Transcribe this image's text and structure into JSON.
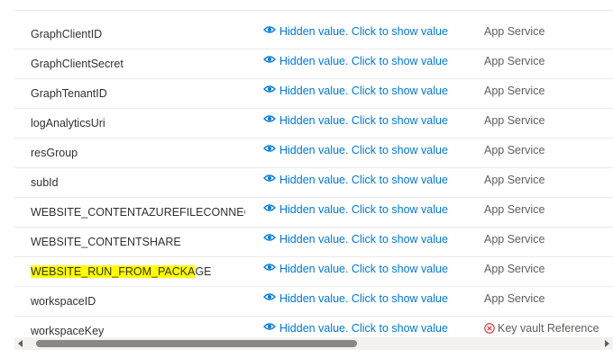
{
  "colors": {
    "link": "#0078d4",
    "text": "#323130",
    "muted": "#605e5c",
    "error": "#d13438",
    "highlight": "#ffff00"
  },
  "settings": [
    {
      "name": "GraphClientID",
      "value_text": "Hidden value. Click to show value",
      "source": "App Service",
      "source_icon": ""
    },
    {
      "name": "GraphClientSecret",
      "value_text": "Hidden value. Click to show value",
      "source": "App Service",
      "source_icon": ""
    },
    {
      "name": "GraphTenantID",
      "value_text": "Hidden value. Click to show value",
      "source": "App Service",
      "source_icon": ""
    },
    {
      "name": "logAnalyticsUri",
      "value_text": "Hidden value. Click to show value",
      "source": "App Service",
      "source_icon": ""
    },
    {
      "name": "resGroup",
      "value_text": "Hidden value. Click to show value",
      "source": "App Service",
      "source_icon": ""
    },
    {
      "name": "subId",
      "value_text": "Hidden value. Click to show value",
      "source": "App Service",
      "source_icon": ""
    },
    {
      "name": "WEBSITE_CONTENTAZUREFILECONNECTIONSTRING",
      "value_text": "Hidden value. Click to show value",
      "source": "App Service",
      "source_icon": ""
    },
    {
      "name": "WEBSITE_CONTENTSHARE",
      "value_text": "Hidden value. Click to show value",
      "source": "App Service",
      "source_icon": ""
    },
    {
      "name_highlighted": "WEBSITE_RUN_FROM_PACKA",
      "name_rest": "GE",
      "value_text": "Hidden value. Click to show value",
      "source": "App Service",
      "source_icon": ""
    },
    {
      "name": "workspaceID",
      "value_text": "Hidden value. Click to show value",
      "source": "App Service",
      "source_icon": ""
    },
    {
      "name": "workspaceKey",
      "value_text": "Hidden value. Click to show value",
      "source": "Key vault Reference",
      "source_icon": "error-circle-icon"
    }
  ],
  "icons": {
    "value": "eye-icon",
    "scroll_left": "scroll-left-arrow-icon",
    "scroll_right": "scroll-right-arrow-icon"
  }
}
